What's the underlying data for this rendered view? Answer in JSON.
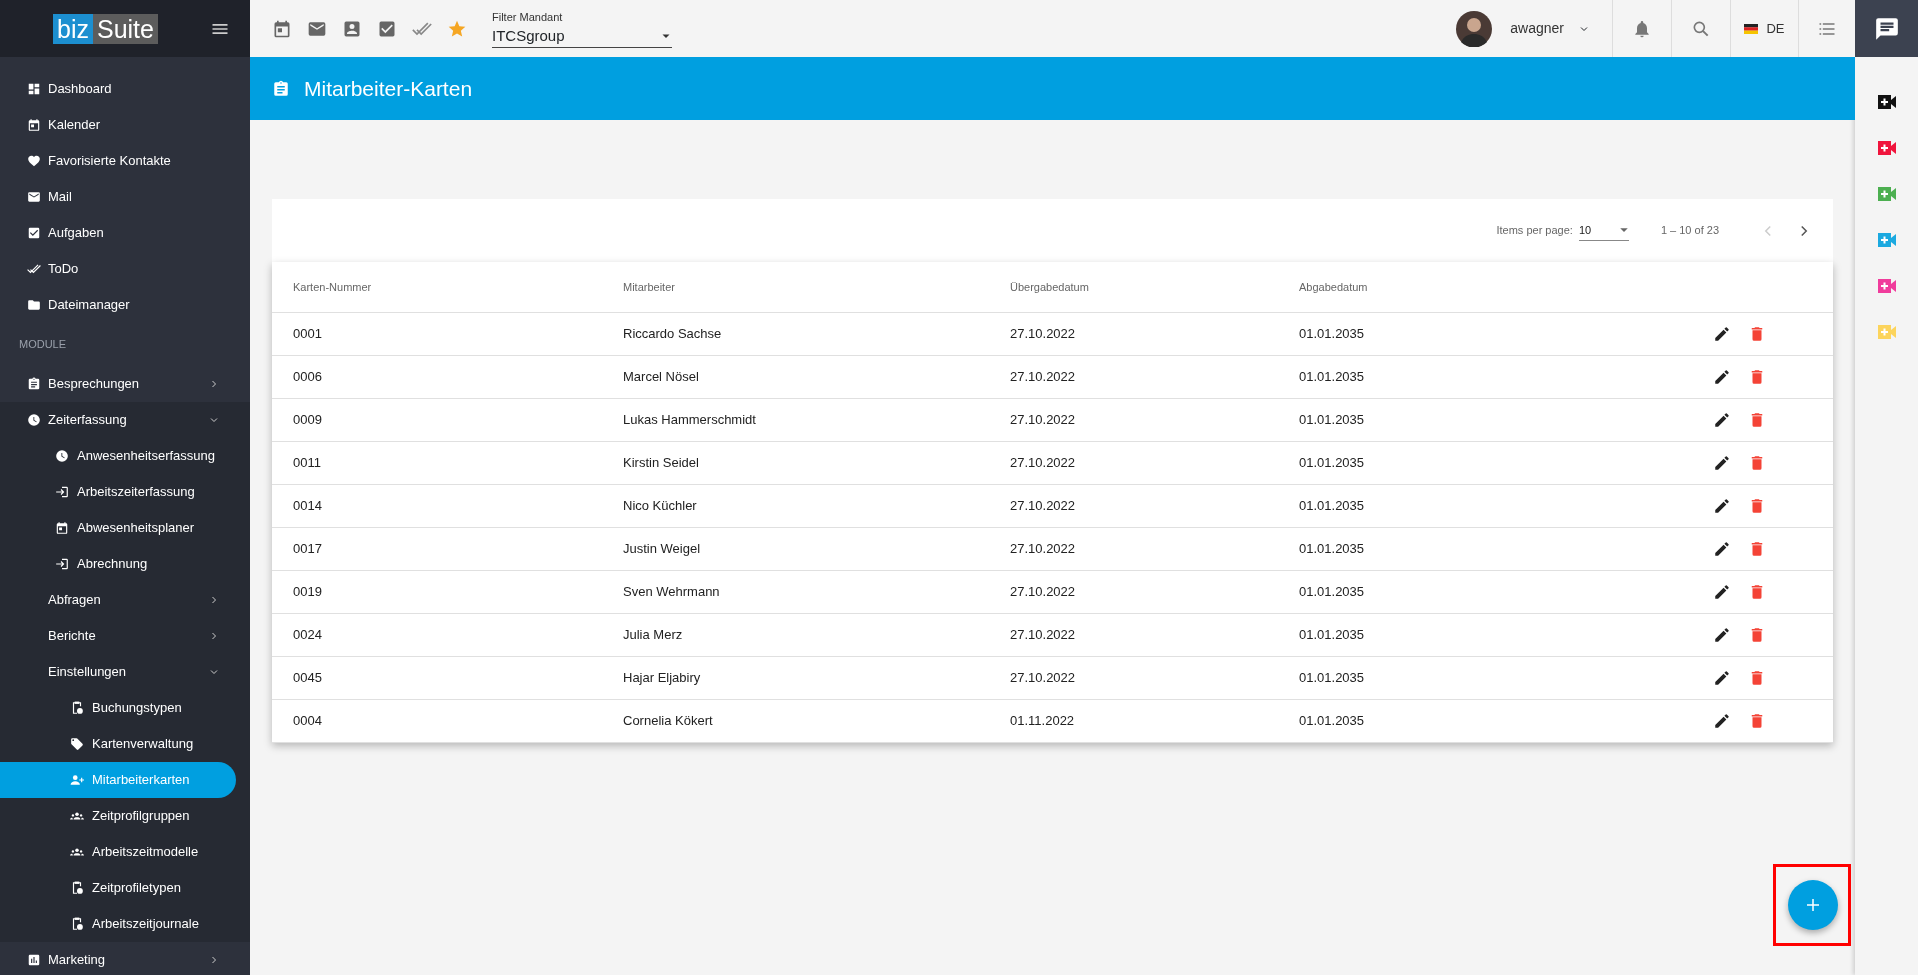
{
  "logo": {
    "left": "biz",
    "right": "Suite"
  },
  "toolbar": {
    "filter": {
      "label": "Filter Mandant",
      "value": "ITCSgroup"
    },
    "user": {
      "name": "awagner"
    },
    "language": "DE"
  },
  "sidebar": {
    "items": [
      {
        "kind": "item",
        "label": "Dashboard",
        "selected": false
      },
      {
        "kind": "item",
        "label": "Kalender",
        "selected": false
      },
      {
        "kind": "item",
        "label": "Favorisierte Kontakte",
        "selected": false
      },
      {
        "kind": "item",
        "label": "Mail",
        "selected": false
      },
      {
        "kind": "item",
        "label": "Aufgaben",
        "selected": false
      },
      {
        "kind": "item",
        "label": "ToDo",
        "selected": false
      },
      {
        "kind": "item",
        "label": "Dateimanager",
        "selected": false
      },
      {
        "kind": "section",
        "label": "MODULE"
      },
      {
        "kind": "item",
        "label": "Besprechungen",
        "selected": false,
        "expanded": false
      },
      {
        "kind": "item",
        "label": "Zeiterfassung",
        "selected": false,
        "expanded": true,
        "children": [
          {
            "kind": "item",
            "label": "Anwesenheitserfassung",
            "selected": false
          },
          {
            "kind": "item",
            "label": "Arbeitszeiterfassung",
            "selected": false
          },
          {
            "kind": "item",
            "label": "Abwesenheitsplaner",
            "selected": false
          },
          {
            "kind": "item",
            "label": "Abrechnung",
            "selected": false
          },
          {
            "kind": "item",
            "label": "Abfragen",
            "selected": false,
            "expanded": false
          },
          {
            "kind": "item",
            "label": "Berichte",
            "selected": false,
            "expanded": false
          },
          {
            "kind": "item",
            "label": "Einstellungen",
            "selected": false,
            "expanded": true,
            "children": [
              {
                "kind": "item",
                "label": "Buchungstypen",
                "selected": false
              },
              {
                "kind": "item",
                "label": "Kartenverwaltung",
                "selected": false
              },
              {
                "kind": "item",
                "label": "Mitarbeiterkarten",
                "selected": true
              },
              {
                "kind": "item",
                "label": "Zeitprofilgruppen",
                "selected": false
              },
              {
                "kind": "item",
                "label": "Arbeitszeitmodelle",
                "selected": false
              },
              {
                "kind": "item",
                "label": "Zeitprofiletypen",
                "selected": false
              },
              {
                "kind": "item",
                "label": "Arbeitszeitjournale",
                "selected": false
              }
            ]
          }
        ]
      },
      {
        "kind": "item",
        "label": "Marketing",
        "selected": false,
        "expanded": false
      }
    ]
  },
  "page_title": "Mitarbeiter-Karten",
  "paginator": {
    "label": "Items per page:",
    "page_size": "10",
    "range": "1 – 10 of 23",
    "previous_disabled": true,
    "next_disabled": false
  },
  "table": {
    "columns": [
      "Karten-Nummer",
      "Mitarbeiter",
      "Übergabedatum",
      "Abgabedatum"
    ],
    "rows": [
      [
        "0001",
        "Riccardo Sachse",
        "27.10.2022",
        "01.01.2035"
      ],
      [
        "0006",
        "Marcel Nösel",
        "27.10.2022",
        "01.01.2035"
      ],
      [
        "0009",
        "Lukas Hammerschmidt",
        "27.10.2022",
        "01.01.2035"
      ],
      [
        "0011",
        "Kirstin Seidel",
        "27.10.2022",
        "01.01.2035"
      ],
      [
        "0014",
        "Nico Küchler",
        "27.10.2022",
        "01.01.2035"
      ],
      [
        "0017",
        "Justin Weigel",
        "27.10.2022",
        "01.01.2035"
      ],
      [
        "0019",
        "Sven Wehrmann",
        "27.10.2022",
        "01.01.2035"
      ],
      [
        "0024",
        "Julia Merz",
        "27.10.2022",
        "01.01.2035"
      ],
      [
        "0045",
        "Hajar Eljabiry",
        "27.10.2022",
        "01.01.2035"
      ],
      [
        "0004",
        "Cornelia Kökert",
        "01.11.2022",
        "01.01.2035"
      ]
    ]
  },
  "right_rail": [
    {
      "color": "#111111"
    },
    {
      "color": "#f0143c"
    },
    {
      "color": "#4caf50"
    },
    {
      "color": "#1ba9e0"
    },
    {
      "color": "#f03c9c"
    },
    {
      "color": "#fcd45c"
    }
  ]
}
